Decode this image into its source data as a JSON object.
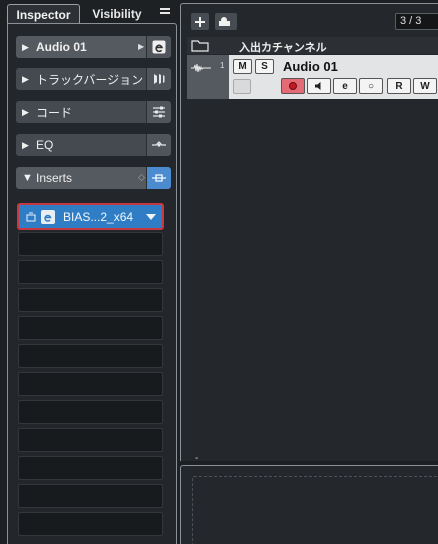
{
  "inspector": {
    "tabs": {
      "inspector": "Inspector",
      "visibility": "Visibility"
    },
    "sections": {
      "track": {
        "label": "Audio 01",
        "icon": "edit-e-icon"
      },
      "track_versions": {
        "label": "トラックバージョン",
        "icon": "versions-icon"
      },
      "chords": {
        "label": "コード",
        "icon": "chord-settings-icon"
      },
      "eq": {
        "label": "EQ",
        "icon": "eq-curve-icon"
      },
      "inserts": {
        "label": "Inserts",
        "icon": "insert-routing-icon"
      }
    },
    "inserts": {
      "active_slot": {
        "name": "BIAS...2_x64"
      },
      "empty_slot_count": 11
    }
  },
  "project": {
    "track_counter": "3 / 3",
    "tracks": [
      {
        "type": "folder",
        "name": "入出カチャンネル"
      },
      {
        "type": "audio",
        "number": "1",
        "name": "Audio 01",
        "mute_label": "M",
        "solo_label": "S",
        "read_label": "R",
        "write_label": "W",
        "edit_label": "e",
        "monitor_label": "○"
      }
    ],
    "bottom_marker": "-"
  },
  "colors": {
    "accent": "#4b8cd0",
    "selected_insert": "#2f7dc4",
    "insert_border": "#c7373f",
    "record_button": "#e46b75"
  }
}
